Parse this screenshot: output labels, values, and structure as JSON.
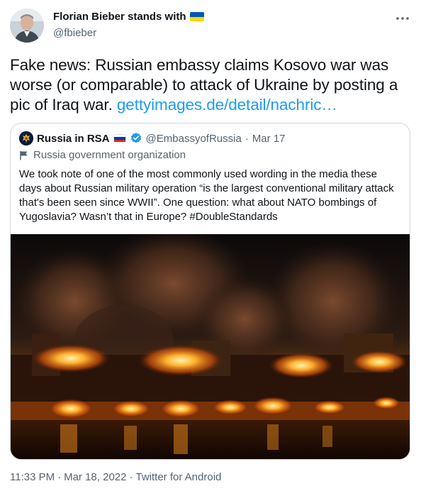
{
  "author": {
    "display_name": "Florian Bieber stands with",
    "handle": "@fbieber",
    "flag": "ukraine-flag"
  },
  "tweet": {
    "text": "Fake news: Russian embassy claims Kosovo war was worse (or comparable) to attack of Ukraine by posting a pic of Iraq war. ",
    "link_text": "gettyimages.de/detail/nachric…"
  },
  "quoted": {
    "name": "Russia in RSA",
    "flag": "russia-flag",
    "verified": true,
    "handle": "@EmbassyofRussia",
    "separator": "·",
    "date": "Mar 17",
    "org_label": "Russia government organization",
    "text": "We took note of one of the most commonly used wording in the media these days about Russian military operation “is the largest conventional military attack that's been seen since WWII”. One question: what about NATO bombings of Yugoslavia? Wasn’t that in Europe? #DoubleStandards",
    "image": "night-city-fires-photo"
  },
  "meta": {
    "time": "11:33 PM",
    "sep1": "·",
    "date": "Mar 18, 2022",
    "sep2": "·",
    "client": "Twitter for Android"
  },
  "colors": {
    "link": "#1d9bf0",
    "text": "#0f1419",
    "muted": "#536471",
    "border": "#cfd9de",
    "verified": "#1d9bf0"
  }
}
